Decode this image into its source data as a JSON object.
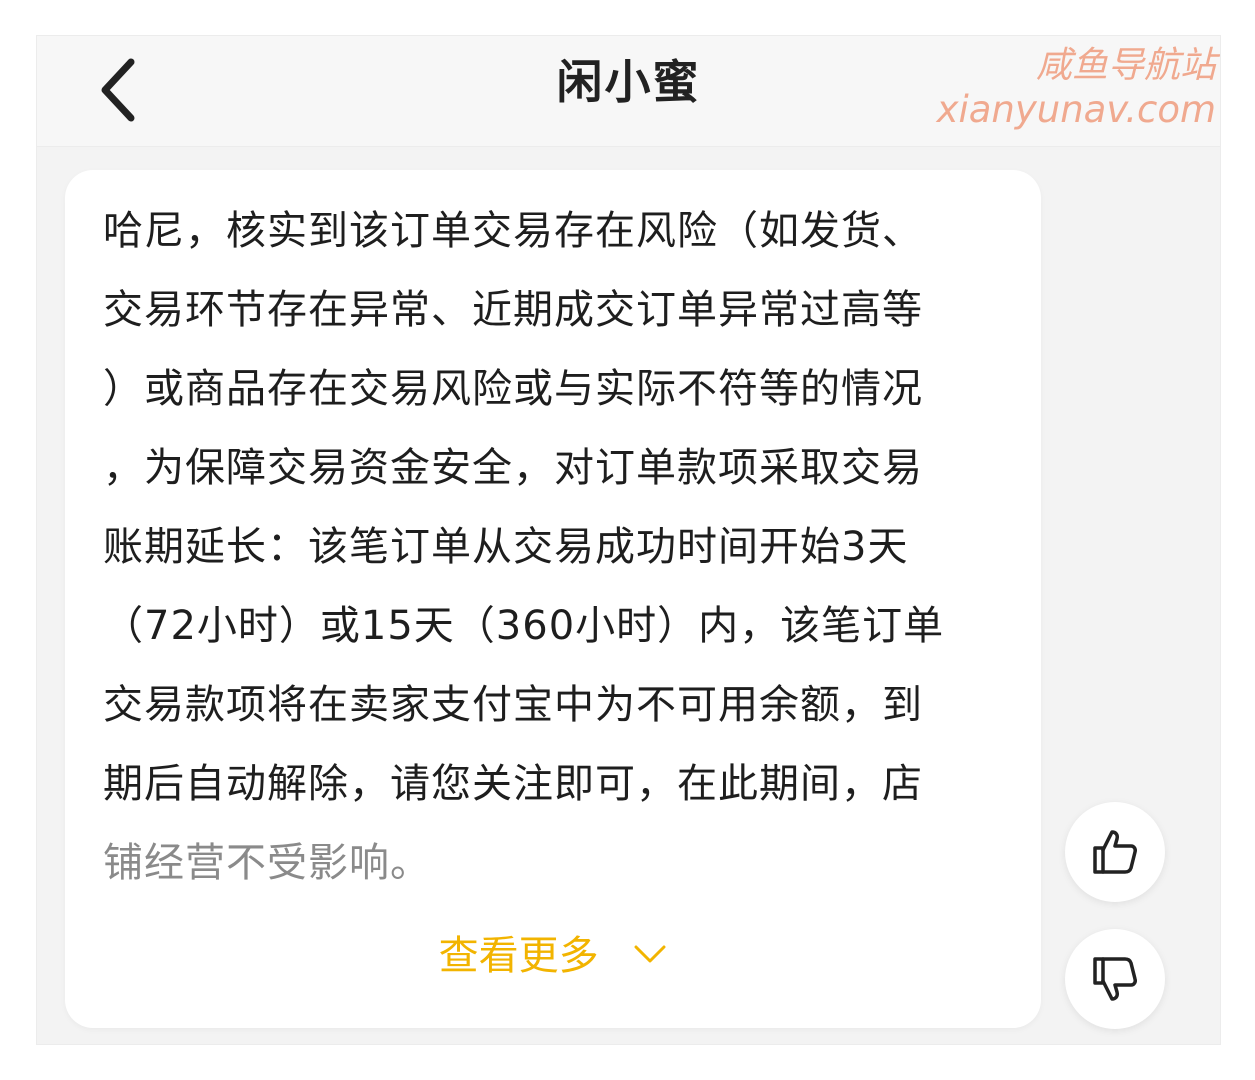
{
  "header": {
    "title": "闲小蜜",
    "back_icon": "chevron-left-icon"
  },
  "watermark": {
    "line1": "咸鱼导航站",
    "line2": "xianyunav.com",
    "color": "#f0a58a"
  },
  "message": {
    "lines": [
      "哈尼，核实到该订单交易存在风险（如发货、",
      "交易环节存在异常、近期成交订单异常过高等",
      "）或商品存在交易风险或与实际不符等的情况",
      "，为保障交易资金安全，对订单款项采取交易",
      "账期延长：该笔订单从交易成功时间开始3天",
      "（72小时）或15天（360小时）内，该笔订单",
      "交易款项将在卖家支付宝中为不可用余额，到",
      "期后自动解除，请您关注即可，在此期间，店",
      "铺经营不受影响。"
    ],
    "more_label": "查看更多",
    "more_icon": "chevron-down-icon",
    "accent": "#f2b400"
  },
  "feedback": {
    "like_icon": "thumbs-up-icon",
    "dislike_icon": "thumbs-down-icon"
  }
}
